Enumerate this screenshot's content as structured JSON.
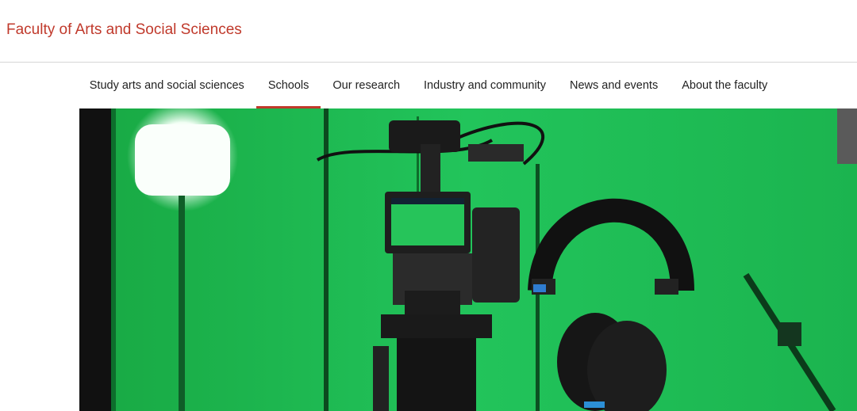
{
  "header": {
    "site_title": "Faculty of Arts and Social Sciences"
  },
  "nav": {
    "items": [
      {
        "label": "Study arts and social sciences"
      },
      {
        "label": "Schools"
      },
      {
        "label": "Our research"
      },
      {
        "label": "Industry and community"
      },
      {
        "label": "News and events"
      },
      {
        "label": "About the faculty"
      }
    ],
    "active": "Schools"
  },
  "hero": {
    "icon": "video-camera-headphones-photo"
  },
  "colors": {
    "accent": "#c0392b",
    "green_screen": "#1fbf55",
    "text": "#222222"
  }
}
